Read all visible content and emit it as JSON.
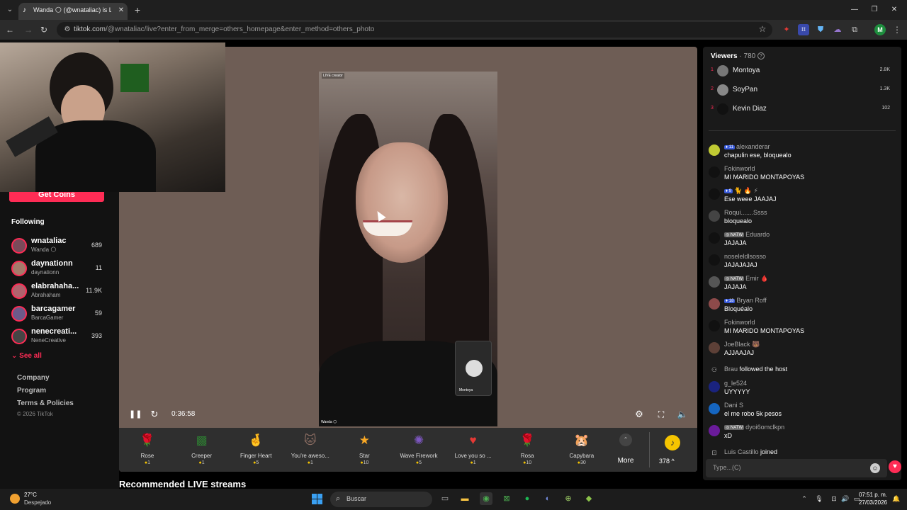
{
  "browser": {
    "tab_title": "Wanda 🌕 (@wnataliac) is LIVE",
    "new_tab": "+",
    "url_host": "tiktok.com",
    "url_path": "/@wnataliac/live?enter_from_merge=others_homepage&enter_method=others_photo"
  },
  "sidebar": {
    "get_coins": "Get Coins",
    "following_title": "Following",
    "following": [
      {
        "name": "wnataliac",
        "sub": "Wanda 🌕",
        "count": "689"
      },
      {
        "name": "daynationn",
        "sub": "daynationn",
        "count": "11"
      },
      {
        "name": "elabrahaha...",
        "sub": "Abrahaham",
        "count": "11.9K"
      },
      {
        "name": "barcagamer",
        "sub": "BarcaGamer",
        "count": "59"
      },
      {
        "name": "nenecreati...",
        "sub": "NeneCreative",
        "count": "393"
      }
    ],
    "see_all": "See all",
    "footer": [
      "Company",
      "Program",
      "Terms & Policies"
    ],
    "copyright": "© 2026 TikTok"
  },
  "player": {
    "live_creator_tag": "LIVE creator",
    "guest_name": "Montoya",
    "host_tag": "Wanda 🌕",
    "time": "0:36:58",
    "gifts": [
      {
        "name": "Rose",
        "price": "1",
        "icon": "🌹",
        "color": "#c2185b"
      },
      {
        "name": "Creeper",
        "price": "1",
        "icon": "▩",
        "color": "#2e7d32"
      },
      {
        "name": "Finger Heart",
        "price": "5",
        "icon": "🤞",
        "color": "#e57373"
      },
      {
        "name": "You're aweso...",
        "price": "1",
        "icon": "🐱",
        "color": "#8d6e63"
      },
      {
        "name": "Star",
        "price": "10",
        "icon": "★",
        "color": "#f9a825"
      },
      {
        "name": "Wave Firework",
        "price": "5",
        "icon": "✺",
        "color": "#7e57c2"
      },
      {
        "name": "Love you so ...",
        "price": "1",
        "icon": "♥",
        "color": "#e53935"
      },
      {
        "name": "Rosa",
        "price": "10",
        "icon": "🌹",
        "color": "#c62828"
      },
      {
        "name": "Capybara",
        "price": "30",
        "icon": "🐹",
        "color": "#a1887f"
      }
    ],
    "more": "More",
    "coin_balance": "378 ^"
  },
  "recommended_title": "Recommended LIVE streams",
  "chat": {
    "viewers_label": "Viewers",
    "viewers_count": "· 780",
    "top_viewers": [
      {
        "rank": "1",
        "name": "Montoya",
        "score": "2.8K"
      },
      {
        "rank": "2",
        "name": "SoyPan",
        "score": "1.3K"
      },
      {
        "rank": "3",
        "name": "Kevin Diaz",
        "score": "102"
      }
    ],
    "messages": [
      {
        "badge": "11",
        "user": "alexanderar",
        "text": "chapulin ese, bloquealo",
        "avatar": "#c0ca33"
      },
      {
        "badge": "",
        "user": "Fokinworld",
        "text": "MI MARIDO MONTAPOYAS",
        "avatar": "#111"
      },
      {
        "badge": "9",
        "user": "🐈 🔥 ⚡",
        "text": "Ese weee JAAJAJ",
        "avatar": "#111"
      },
      {
        "badge": "",
        "user": "Roqui.......Ssss",
        "text": "bloquealo",
        "avatar": "#444"
      },
      {
        "badge": "NATW",
        "user": "Eduardo",
        "text": "JAJAJA",
        "avatar": "#111"
      },
      {
        "badge": "",
        "user": "noseleldlsosso",
        "text": "JAJAJAJAJ",
        "avatar": "#111"
      },
      {
        "badge": "NATW",
        "user": "Emir 🩸",
        "text": "JAJAJA",
        "avatar": "#555"
      },
      {
        "badge": "18",
        "user": "Bryan Roff",
        "text": "Bloquéalo",
        "avatar": "#8d4a4a"
      },
      {
        "badge": "",
        "user": "Fokinworld",
        "text": "MI MARIDO MONTAPOYAS",
        "avatar": "#111"
      },
      {
        "badge": "",
        "user": "JoeBlack 🐻",
        "text": "AJJAAJAJ",
        "avatar": "#5d4037"
      }
    ],
    "follow_event_user": "Brau",
    "follow_event_text": "followed the host",
    "messages2": [
      {
        "badge": "",
        "user": "g_le524",
        "text": "UYYYYY",
        "avatar": "#1a237e"
      },
      {
        "badge": "",
        "user": "Dani S",
        "text": "el me robo 5k pesos",
        "avatar": "#1565c0"
      },
      {
        "badge": "NATW",
        "user": "dyoi6omclkpn",
        "text": "xD",
        "avatar": "#6a1b9a"
      }
    ],
    "join_event_user": "Luis Castillo",
    "join_event_text": "joined",
    "input_placeholder": "Type...(C)"
  },
  "taskbar": {
    "temp": "27°C",
    "weather": "Despejado",
    "search": "Buscar",
    "time": "07:51 p. m.",
    "date": "27/03/2026"
  }
}
